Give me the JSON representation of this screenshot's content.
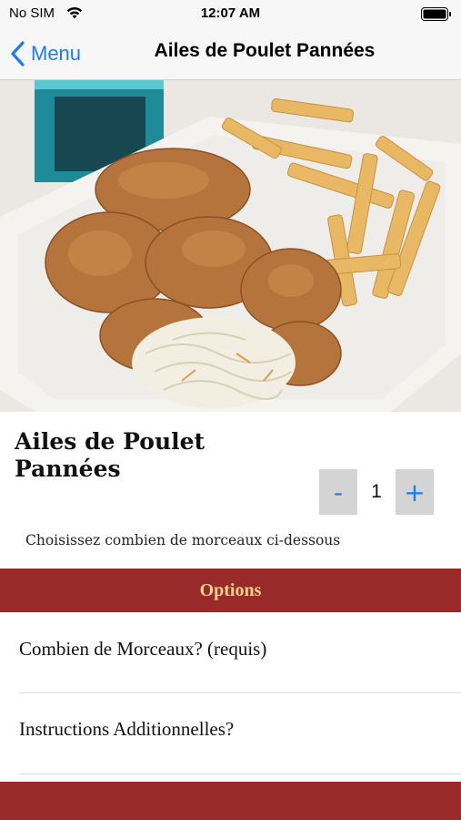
{
  "status_bar": {
    "carrier": "No SIM",
    "time": "12:07 AM",
    "icons": [
      "wifi-icon",
      "battery-icon"
    ]
  },
  "navbar": {
    "back_label": "Menu",
    "title": "Ailes de Poulet Pannées"
  },
  "hero": {
    "description_icon": "food-photo"
  },
  "item": {
    "title": "Ailes de Poulet Pannées",
    "quantity": {
      "minus_label": "-",
      "value": "1",
      "plus_label": "+"
    },
    "description": "Choisissez combien de morceaux ci-dessous"
  },
  "options": {
    "header": "Options",
    "rows": [
      {
        "label": "Combien de Morceaux? (requis)"
      },
      {
        "label": "Instructions Additionnelles?"
      }
    ]
  },
  "colors": {
    "accent_blue": "#1a7cf5",
    "maroon": "#9a2a2a",
    "gold": "#f2d48a"
  }
}
